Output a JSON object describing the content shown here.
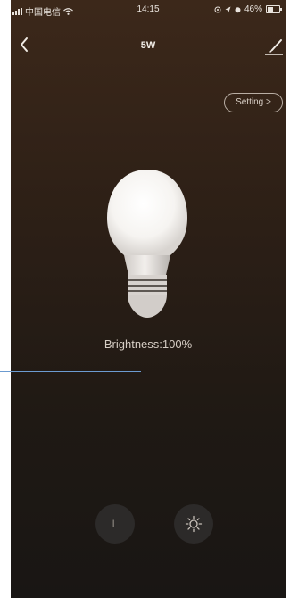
{
  "status_bar": {
    "carrier": "中国电信",
    "time": "14:15",
    "battery_text": "46%",
    "battery_level": 0.46
  },
  "nav": {
    "title": "5W"
  },
  "setting_button": {
    "label": "Setting >"
  },
  "bulb": {
    "brightness_text": "Brightness:100%",
    "brightness_level": 1.0
  },
  "controls": {
    "timer_label": "L"
  },
  "colors": {
    "background_top": "#3c281a",
    "background_bottom": "#191614",
    "annotation_line": "#6c9bd0"
  },
  "icons": [
    "signal-icon",
    "wifi-icon",
    "location-icon",
    "alarm-icon",
    "battery-icon",
    "back-chevron-icon",
    "edit-pen-icon",
    "bulb-icon",
    "sun-icon"
  ]
}
